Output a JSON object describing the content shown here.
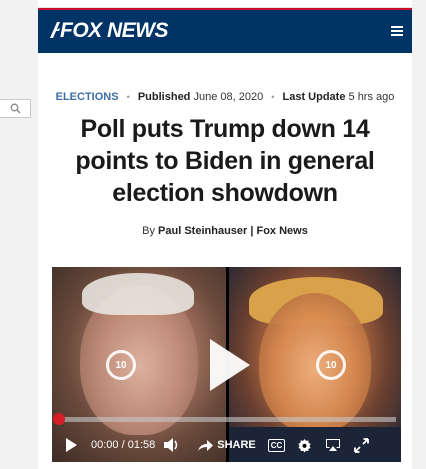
{
  "header": {
    "logo_text": "FOX NEWS",
    "brand_color": "#003366",
    "accent_color": "#c8102e"
  },
  "article": {
    "category": "ELECTIONS",
    "published_label": "Published",
    "published_date": "June 08, 2020",
    "updated_label": "Last Update",
    "updated_ago": "5 hrs ago",
    "headline": "Poll puts Trump down 14 points to Biden in general election showdown",
    "byline_prefix": "By",
    "author": "Paul Steinhauser | Fox News"
  },
  "video": {
    "rewind_seconds": "10",
    "forward_seconds": "10",
    "current_time": "00:00",
    "time_separator": "/",
    "duration": "01:58",
    "progress_fraction": 0.0,
    "share_label": "SHARE",
    "cc_label": "CC",
    "progress_color": "#d41f26"
  },
  "icons": [
    "search-icon",
    "menu-icon",
    "rewind-10-icon",
    "play-icon",
    "forward-10-icon",
    "volume-icon",
    "share-icon",
    "closed-captions-icon",
    "settings-icon",
    "airplay-icon",
    "fullscreen-icon"
  ]
}
